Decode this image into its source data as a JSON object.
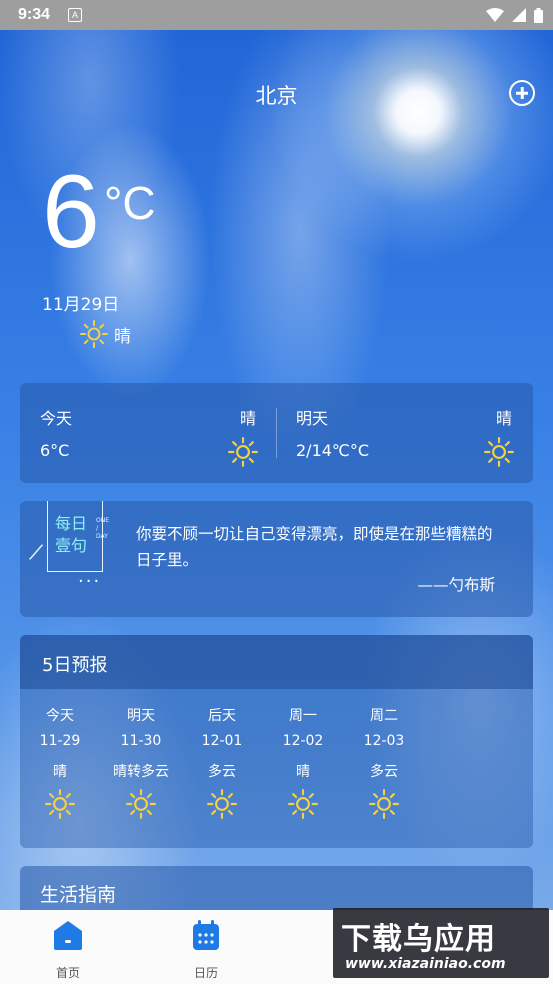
{
  "status_bar": {
    "time": "9:34",
    "badge": "A"
  },
  "header": {
    "city": "北京"
  },
  "current": {
    "temp": "6",
    "unit": "°C",
    "date": "11月29日",
    "condition": "晴"
  },
  "today_tomorrow": [
    {
      "label": "今天",
      "condition": "晴",
      "temp": "6°C"
    },
    {
      "label": "明天",
      "condition": "晴",
      "temp": "2/14℃°C"
    }
  ],
  "quote": {
    "logo_line1": "每日",
    "logo_line2": "壹句",
    "logo_small1": "ONE",
    "logo_small2": "/",
    "logo_small3": "DAY",
    "dots": "···",
    "text": "你要不顾一切让自己变得漂亮，即使是在那些糟糕的日子里。",
    "author": "——勺布斯"
  },
  "forecast": {
    "title": "5日预报",
    "days": [
      {
        "day": "今天",
        "date": "11-29",
        "condition": "晴"
      },
      {
        "day": "明天",
        "date": "11-30",
        "condition": "晴转多云"
      },
      {
        "day": "后天",
        "date": "12-01",
        "condition": "多云"
      },
      {
        "day": "周一",
        "date": "12-02",
        "condition": "晴"
      },
      {
        "day": "周二",
        "date": "12-03",
        "condition": "多云"
      }
    ]
  },
  "guide": {
    "title": "生活指南"
  },
  "tabbar": [
    {
      "label": "首页",
      "icon": "home-icon"
    },
    {
      "label": "日历",
      "icon": "calendar-icon"
    }
  ],
  "watermark": {
    "big": "下载乌应用",
    "small": "www.xiazainiao.com"
  },
  "colors": {
    "sun_icon": "#f5d142",
    "tab_active": "#1e7be6"
  }
}
